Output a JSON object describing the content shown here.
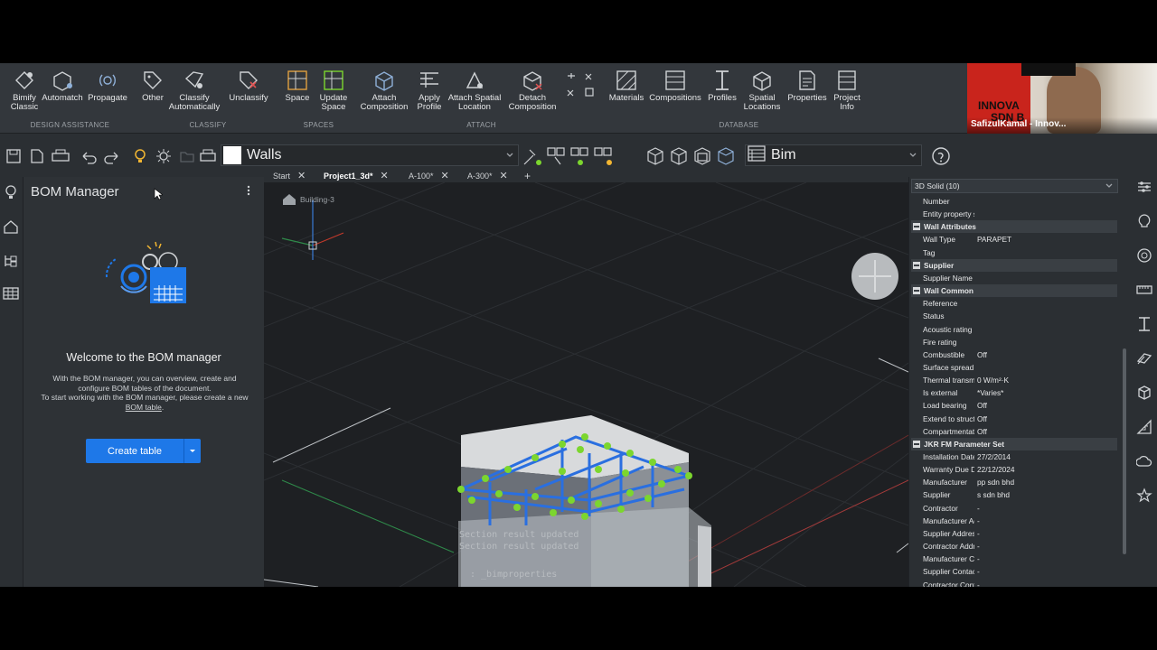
{
  "ribbon": {
    "buttons": [
      {
        "label": "Bimify\nClassic",
        "icon": "bimify-classic-icon"
      },
      {
        "label": "Automatch",
        "icon": "automatch-icon"
      },
      {
        "label": "Propagate",
        "icon": "propagate-icon"
      },
      {
        "label": "Other",
        "icon": "tag-icon"
      },
      {
        "label": "Classify\nAutomatically",
        "icon": "classify-auto-icon"
      },
      {
        "label": "Unclassify",
        "icon": "unclassify-icon"
      },
      {
        "label": "Space",
        "icon": "space-icon"
      },
      {
        "label": "Update\nSpace",
        "icon": "update-space-icon"
      },
      {
        "label": "Attach\nComposition",
        "icon": "attach-composition-icon"
      },
      {
        "label": "Apply\nProfile",
        "icon": "apply-profile-icon"
      },
      {
        "label": "Attach Spatial\nLocation",
        "icon": "attach-spatial-icon"
      },
      {
        "label": "Detach\nComposition",
        "icon": "detach-composition-icon"
      },
      {
        "label": "Materials",
        "icon": "materials-icon"
      },
      {
        "label": "Compositions",
        "icon": "compositions-icon"
      },
      {
        "label": "Profiles",
        "icon": "profiles-icon"
      },
      {
        "label": "Spatial\nLocations",
        "icon": "spatial-locations-icon"
      },
      {
        "label": "Properties",
        "icon": "properties-icon"
      },
      {
        "label": "Project\nInfo",
        "icon": "project-info-icon"
      }
    ],
    "groups": {
      "design_assistance": "DESIGN ASSISTANCE",
      "classify": "CLASSIFY",
      "spaces": "SPACES",
      "attach": "ATTACH",
      "database": "DATABASE"
    }
  },
  "webcam": {
    "name": "SafizulKamal - Innov...",
    "banner_line1": "INNOVA",
    "banner_line2": "SDN B"
  },
  "toolbar": {
    "layer": "Walls",
    "workspace": "Bim"
  },
  "tabs": [
    {
      "label": "Start",
      "active": false
    },
    {
      "label": "Project1_3d*",
      "active": true
    },
    {
      "label": "A-100*",
      "active": false
    },
    {
      "label": "A-300*",
      "active": false
    }
  ],
  "bom": {
    "title": "BOM Manager",
    "welcome": "Welcome to the BOM manager",
    "desc_line1": "With the BOM manager, you can overview, create and",
    "desc_line2": "configure BOM tables of the document.",
    "desc_line3": "To start working with the BOM manager, please create a new",
    "desc_link": "BOM table",
    "desc_end": ".",
    "create_label": "Create table"
  },
  "viewport": {
    "breadcrumb": "Building-3",
    "command_lines": [
      "Section result updated",
      "Section result updated",
      ": _bimproperties"
    ]
  },
  "properties": {
    "selection": "3D Solid (10)",
    "rows": [
      {
        "k": "Number",
        "v": ""
      },
      {
        "k": "Entity property set",
        "v": ""
      },
      {
        "section": "Wall Attributes"
      },
      {
        "k": "Wall Type",
        "v": "PARAPET"
      },
      {
        "k": "Tag",
        "v": ""
      },
      {
        "section": "Supplier"
      },
      {
        "k": "Supplier Name",
        "v": ""
      },
      {
        "section": "Wall Common"
      },
      {
        "k": "Reference",
        "v": ""
      },
      {
        "k": "Status",
        "v": ""
      },
      {
        "k": "Acoustic rating",
        "v": ""
      },
      {
        "k": "Fire rating",
        "v": ""
      },
      {
        "k": "Combustible",
        "v": "Off"
      },
      {
        "k": "Surface spread of",
        "v": ""
      },
      {
        "k": "Thermal transmitt",
        "v": "0 W/m²·K"
      },
      {
        "k": "Is external",
        "v": "*Varies*"
      },
      {
        "k": "Load bearing",
        "v": "Off"
      },
      {
        "k": "Extend to structur",
        "v": "Off"
      },
      {
        "k": "Compartmentation",
        "v": "Off"
      },
      {
        "section": "JKR FM Parameter Set"
      },
      {
        "k": "Installation Date",
        "v": "27/2/2014"
      },
      {
        "k": "Warranty Due Dat",
        "v": "22/12/2024"
      },
      {
        "k": "Manufacturer",
        "v": "pp sdn bhd"
      },
      {
        "k": "Supplier",
        "v": "s sdn bhd"
      },
      {
        "k": "Contractor",
        "v": "-"
      },
      {
        "k": "Manufacturer Add",
        "v": "-"
      },
      {
        "k": "Supplier Address",
        "v": "-"
      },
      {
        "k": "Contractor Addres",
        "v": "-"
      },
      {
        "k": "Manufacturer Con",
        "v": "-"
      },
      {
        "k": "Supplier Contact N",
        "v": "-"
      },
      {
        "k": "Contractor Contac",
        "v": "-"
      }
    ]
  },
  "colors": {
    "accent": "#1e78e8",
    "model_green": "#7cd62e",
    "model_blue": "#2a6fe0"
  }
}
